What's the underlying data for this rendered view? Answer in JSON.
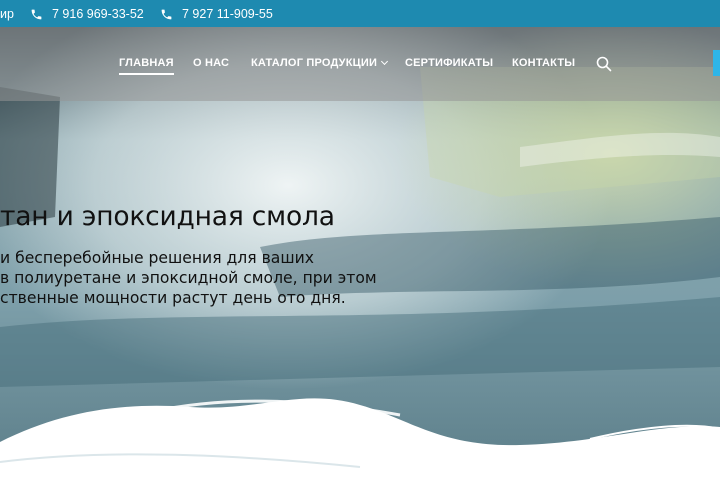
{
  "topbar": {
    "fragment": "ир",
    "phones": [
      "7 916 969-33-52",
      "7 927 11-909-55"
    ]
  },
  "nav": {
    "items": [
      "ГЛАВНАЯ",
      "О НАС",
      "КАТАЛОГ ПРОДУКЦИИ",
      "СЕРТИФИКАТЫ",
      "КОНТАКТЫ"
    ],
    "active": "ГЛАВНАЯ",
    "icons": [
      "phone-icon",
      "search-icon",
      "chevron-down-icon"
    ]
  },
  "hero": {
    "title": "тан и эпоксидная смола",
    "lines": [
      "и бесперебойные решения для ваших",
      "в полиуретане и эпоксидной смоле, при этом",
      "ственные мощности растут день ото дня."
    ]
  },
  "colors": {
    "topbar": "#1e8ab0",
    "accent": "#2eb5e8",
    "text": "#111111"
  }
}
